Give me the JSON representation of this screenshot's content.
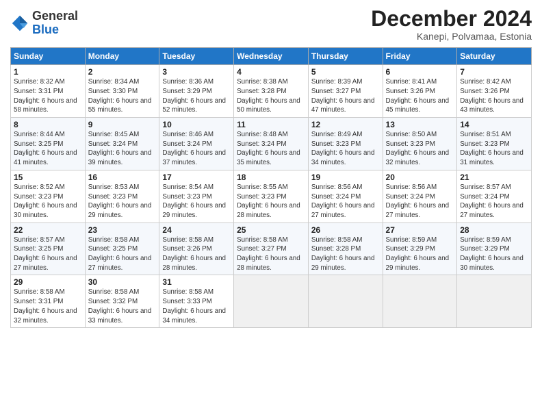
{
  "logo": {
    "general": "General",
    "blue": "Blue"
  },
  "title": "December 2024",
  "subtitle": "Kanepi, Polvamaa, Estonia",
  "days_header": [
    "Sunday",
    "Monday",
    "Tuesday",
    "Wednesday",
    "Thursday",
    "Friday",
    "Saturday"
  ],
  "weeks": [
    [
      {
        "day": "1",
        "sunrise": "Sunrise: 8:32 AM",
        "sunset": "Sunset: 3:31 PM",
        "daylight": "Daylight: 6 hours and 58 minutes."
      },
      {
        "day": "2",
        "sunrise": "Sunrise: 8:34 AM",
        "sunset": "Sunset: 3:30 PM",
        "daylight": "Daylight: 6 hours and 55 minutes."
      },
      {
        "day": "3",
        "sunrise": "Sunrise: 8:36 AM",
        "sunset": "Sunset: 3:29 PM",
        "daylight": "Daylight: 6 hours and 52 minutes."
      },
      {
        "day": "4",
        "sunrise": "Sunrise: 8:38 AM",
        "sunset": "Sunset: 3:28 PM",
        "daylight": "Daylight: 6 hours and 50 minutes."
      },
      {
        "day": "5",
        "sunrise": "Sunrise: 8:39 AM",
        "sunset": "Sunset: 3:27 PM",
        "daylight": "Daylight: 6 hours and 47 minutes."
      },
      {
        "day": "6",
        "sunrise": "Sunrise: 8:41 AM",
        "sunset": "Sunset: 3:26 PM",
        "daylight": "Daylight: 6 hours and 45 minutes."
      },
      {
        "day": "7",
        "sunrise": "Sunrise: 8:42 AM",
        "sunset": "Sunset: 3:26 PM",
        "daylight": "Daylight: 6 hours and 43 minutes."
      }
    ],
    [
      {
        "day": "8",
        "sunrise": "Sunrise: 8:44 AM",
        "sunset": "Sunset: 3:25 PM",
        "daylight": "Daylight: 6 hours and 41 minutes."
      },
      {
        "day": "9",
        "sunrise": "Sunrise: 8:45 AM",
        "sunset": "Sunset: 3:24 PM",
        "daylight": "Daylight: 6 hours and 39 minutes."
      },
      {
        "day": "10",
        "sunrise": "Sunrise: 8:46 AM",
        "sunset": "Sunset: 3:24 PM",
        "daylight": "Daylight: 6 hours and 37 minutes."
      },
      {
        "day": "11",
        "sunrise": "Sunrise: 8:48 AM",
        "sunset": "Sunset: 3:24 PM",
        "daylight": "Daylight: 6 hours and 35 minutes."
      },
      {
        "day": "12",
        "sunrise": "Sunrise: 8:49 AM",
        "sunset": "Sunset: 3:23 PM",
        "daylight": "Daylight: 6 hours and 34 minutes."
      },
      {
        "day": "13",
        "sunrise": "Sunrise: 8:50 AM",
        "sunset": "Sunset: 3:23 PM",
        "daylight": "Daylight: 6 hours and 32 minutes."
      },
      {
        "day": "14",
        "sunrise": "Sunrise: 8:51 AM",
        "sunset": "Sunset: 3:23 PM",
        "daylight": "Daylight: 6 hours and 31 minutes."
      }
    ],
    [
      {
        "day": "15",
        "sunrise": "Sunrise: 8:52 AM",
        "sunset": "Sunset: 3:23 PM",
        "daylight": "Daylight: 6 hours and 30 minutes."
      },
      {
        "day": "16",
        "sunrise": "Sunrise: 8:53 AM",
        "sunset": "Sunset: 3:23 PM",
        "daylight": "Daylight: 6 hours and 29 minutes."
      },
      {
        "day": "17",
        "sunrise": "Sunrise: 8:54 AM",
        "sunset": "Sunset: 3:23 PM",
        "daylight": "Daylight: 6 hours and 29 minutes."
      },
      {
        "day": "18",
        "sunrise": "Sunrise: 8:55 AM",
        "sunset": "Sunset: 3:23 PM",
        "daylight": "Daylight: 6 hours and 28 minutes."
      },
      {
        "day": "19",
        "sunrise": "Sunrise: 8:56 AM",
        "sunset": "Sunset: 3:24 PM",
        "daylight": "Daylight: 6 hours and 27 minutes."
      },
      {
        "day": "20",
        "sunrise": "Sunrise: 8:56 AM",
        "sunset": "Sunset: 3:24 PM",
        "daylight": "Daylight: 6 hours and 27 minutes."
      },
      {
        "day": "21",
        "sunrise": "Sunrise: 8:57 AM",
        "sunset": "Sunset: 3:24 PM",
        "daylight": "Daylight: 6 hours and 27 minutes."
      }
    ],
    [
      {
        "day": "22",
        "sunrise": "Sunrise: 8:57 AM",
        "sunset": "Sunset: 3:25 PM",
        "daylight": "Daylight: 6 hours and 27 minutes."
      },
      {
        "day": "23",
        "sunrise": "Sunrise: 8:58 AM",
        "sunset": "Sunset: 3:25 PM",
        "daylight": "Daylight: 6 hours and 27 minutes."
      },
      {
        "day": "24",
        "sunrise": "Sunrise: 8:58 AM",
        "sunset": "Sunset: 3:26 PM",
        "daylight": "Daylight: 6 hours and 28 minutes."
      },
      {
        "day": "25",
        "sunrise": "Sunrise: 8:58 AM",
        "sunset": "Sunset: 3:27 PM",
        "daylight": "Daylight: 6 hours and 28 minutes."
      },
      {
        "day": "26",
        "sunrise": "Sunrise: 8:58 AM",
        "sunset": "Sunset: 3:28 PM",
        "daylight": "Daylight: 6 hours and 29 minutes."
      },
      {
        "day": "27",
        "sunrise": "Sunrise: 8:59 AM",
        "sunset": "Sunset: 3:29 PM",
        "daylight": "Daylight: 6 hours and 29 minutes."
      },
      {
        "day": "28",
        "sunrise": "Sunrise: 8:59 AM",
        "sunset": "Sunset: 3:29 PM",
        "daylight": "Daylight: 6 hours and 30 minutes."
      }
    ],
    [
      {
        "day": "29",
        "sunrise": "Sunrise: 8:58 AM",
        "sunset": "Sunset: 3:31 PM",
        "daylight": "Daylight: 6 hours and 32 minutes."
      },
      {
        "day": "30",
        "sunrise": "Sunrise: 8:58 AM",
        "sunset": "Sunset: 3:32 PM",
        "daylight": "Daylight: 6 hours and 33 minutes."
      },
      {
        "day": "31",
        "sunrise": "Sunrise: 8:58 AM",
        "sunset": "Sunset: 3:33 PM",
        "daylight": "Daylight: 6 hours and 34 minutes."
      },
      null,
      null,
      null,
      null
    ]
  ]
}
